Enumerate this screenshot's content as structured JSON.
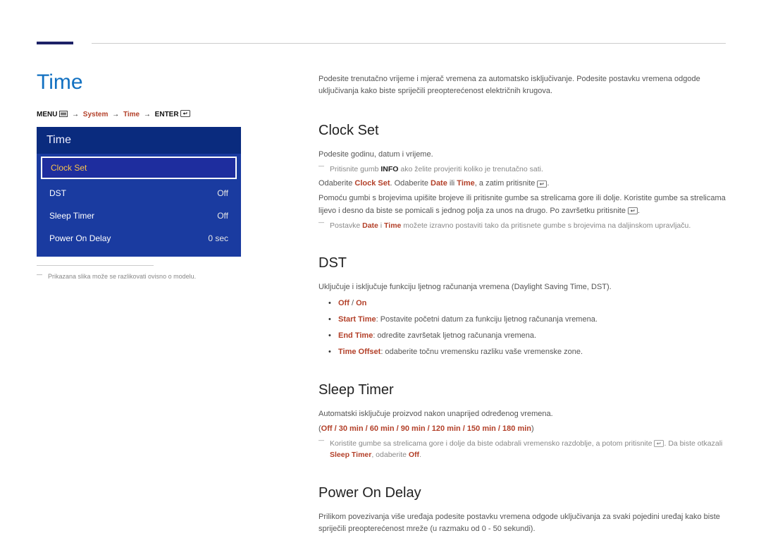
{
  "page_title": "Time",
  "menu_path": {
    "menu_label": "MENU",
    "system_label": "System",
    "time_label": "Time",
    "enter_label": "ENTER"
  },
  "panel": {
    "header": "Time",
    "rows": [
      {
        "label": "Clock Set",
        "value": "",
        "highlight": true
      },
      {
        "label": "DST",
        "value": "Off",
        "highlight": false
      },
      {
        "label": "Sleep Timer",
        "value": "Off",
        "highlight": false
      },
      {
        "label": "Power On Delay",
        "value": "0 sec",
        "highlight": false
      }
    ],
    "note": "Prikazana slika može se razlikovati ovisno o modelu."
  },
  "intro": "Podesite trenutačno vrijeme i mjerač vremena za automatsko isključivanje. Podesite postavku vremena odgode uključivanja kako biste spriječili preopterećenost električnih krugova.",
  "sections": {
    "clockset": {
      "title": "Clock Set",
      "p1": "Podesite godinu, datum i vrijeme.",
      "note1_pre": "Pritisnite gumb ",
      "note1_bold": "INFO",
      "note1_post": " ako želite provjeriti koliko je trenutačno sati.",
      "p2_pre": "Odaberite ",
      "p2_cs": "Clock Set",
      "p2_mid": ". Odaberite ",
      "p2_date": "Date",
      "p2_or": " ili ",
      "p2_time": "Time",
      "p2_post": ", a zatim pritisnite ",
      "p2_end": ".",
      "p3_pre": "Pomoću gumbi s brojevima upišite brojeve ili pritisnite gumbe sa strelicama gore ili dolje. Koristite gumbe sa strelicama lijevo i desno da biste se pomicali s jednog polja za unos na drugo. Po završetku pritisnite ",
      "p3_end": ".",
      "note2_pre": "Postavke ",
      "note2_date": "Date",
      "note2_and": " i ",
      "note2_time": "Time",
      "note2_post": " možete izravno postaviti tako da pritisnete gumbe s brojevima na daljinskom upravljaču."
    },
    "dst": {
      "title": "DST",
      "p1": "Uključuje i isključuje funkciju ljetnog računanja vremena (Daylight Saving Time, DST).",
      "opt_off": "Off",
      "opt_sep": " / ",
      "opt_on": "On",
      "start_label": "Start Time",
      "start_text": ": Postavite početni datum za funkciju ljetnog računanja vremena.",
      "end_label": "End Time",
      "end_text": ": odredite završetak ljetnog računanja vremena.",
      "offset_label": "Time Offset",
      "offset_text": ": odaberite točnu vremensku razliku vaše vremenske zone."
    },
    "sleep": {
      "title": "Sleep Timer",
      "p1": "Automatski isključuje proizvod nakon unaprijed određenog vremena.",
      "opts_open": "(",
      "opts": "Off / 30 min / 60 min / 90 min / 120 min / 150 min / 180 min",
      "opts_close": ")",
      "note_pre": "Koristite gumbe sa strelicama gore i dolje da biste odabrali vremensko razdoblje, a potom pritisnite ",
      "note_mid": ". Da biste otkazali ",
      "note_st": "Sleep Timer",
      "note_sep": ", odaberite ",
      "note_off": "Off",
      "note_end": "."
    },
    "pod": {
      "title": "Power On Delay",
      "p1": "Prilikom povezivanja više uređaja podesite postavku vremena odgode uključivanja za svaki pojedini uređaj kako biste spriječili preopterećenost mreže (u razmaku od 0 - 50 sekundi)."
    }
  }
}
